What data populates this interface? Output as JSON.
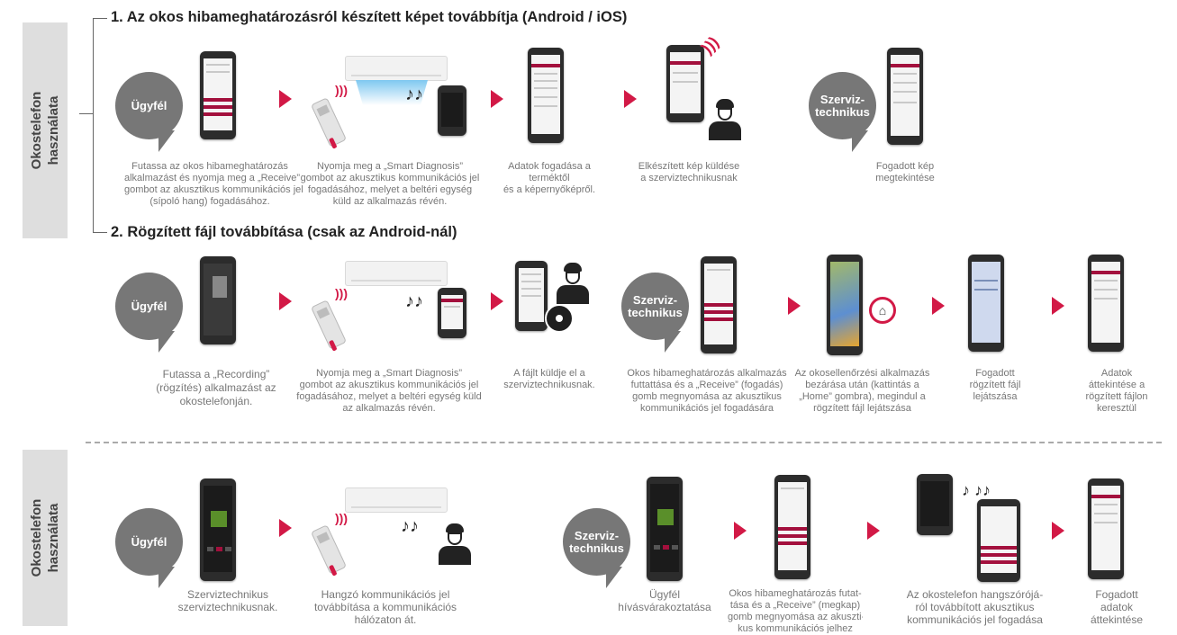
{
  "side_labels": {
    "top": "Okostelefon\nhasználata",
    "bottom": "Okostelefon\nhasználata"
  },
  "section1": {
    "title": "1. Az okos hibameghatározásról készített képet továbbítja (Android / iOS)",
    "customer_bubble": "Ügyfél",
    "technician_bubble": "Szerviz-\ntechnikus",
    "captions": [
      "Futassa az okos hibameghatározás\nalkalmazást és nyomja meg a „Receive”\ngombot az akusztikus kommunikációs jel\n(sípoló hang) fogadásához.",
      "Nyomja meg a „Smart Diagnosis”\ngombot az akusztikus kommunikációs jel\nfogadásához, melyet a beltéri egység\nküld az alkalmazás révén.",
      "Adatok fogadása a\nterméktől\nés a képernyőképről.",
      "Elkészített kép küldése\na szerviztechnikusnak",
      "Fogadott kép\nmegtekintése"
    ]
  },
  "section2": {
    "title": "2. Rögzített fájl továbbítása (csak az Android-nál)",
    "customer_bubble": "Ügyfél",
    "technician_bubble": "Szerviz-\ntechnikus",
    "captions": [
      "Futassa a „Recording”\n(rögzítés) alkalmazást az\nokostelefonján.",
      "Nyomja meg a „Smart Diagnosis”\ngombot az akusztikus kommunikációs jel\nfogadásához, melyet a beltéri egység küld\naz alkalmazás révén.",
      "A fájlt küldje el a\nszerviztechnikusnak.",
      "Okos hibameghatározás alkalmazás\nfuttattása és a „Receive” (fogadás)\ngomb megnyomása az akusztikus\nkommunikációs jel fogadására",
      "Az okosellenőrzési alkalmazás\nbezárása után (kattintás a\n„Home” gombra), megindul a\nrögzített fájl lejátszása",
      "Fogadott\nrögzített fájl\nlejátszása",
      "Adatok\náttekintése a\nrögzített fájlon\nkeresztül"
    ]
  },
  "section3": {
    "customer_bubble": "Ügyfél",
    "technician_bubble": "Szerviz-\ntechnikus",
    "captions": [
      "Szerviztechnikus\nszerviztechnikusnak.",
      "Hangzó kommunikációs jel\ntovábbítása a kommunikációs\nhálózaton át.",
      "Ügyfél\nhívásvárakoztatása",
      "Okos hibameghatározás futat-\ntása és a „Receive” (megkap)\ngomb megnyomása az akuszti-\nkus kommunikációs jelhez",
      "Az okostelefon hangszórójá-\nról továbbított akusztikus\nkommunikációs jel fogadása",
      "Fogadott\nadatok\náttekintése"
    ]
  },
  "colors": {
    "accent": "#d21946",
    "bubble": "#777777",
    "side_tab": "#dedede"
  }
}
